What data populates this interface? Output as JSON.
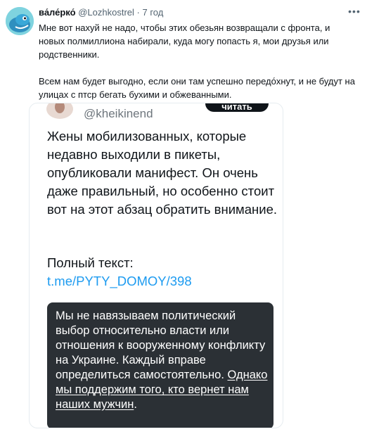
{
  "post": {
    "author_name": "ва́ле́рко́",
    "handle": "@Lozhkostrel",
    "separator": "·",
    "time": "7 год",
    "more_icon": "more-horizontal-icon",
    "paragraph1": "Мне вот нахуй не надо, чтобы этих обезьян возвращали с фронта, и новых полмиллиона набирали, куда могу попасть я, мои друзья или родственники.",
    "paragraph2": "Всем нам будет выгодно, если они там успешно передо́хнут, и не будут на улицах с птср бегать бухими и обжеванными."
  },
  "quoted": {
    "handle": "@kheikinend",
    "button_label": "читать",
    "text": "Жены мобилизованных, которые недавно выходили в пикеты, опубликовали манифест. Он очень даже правильный, но особенно стоит вот на этот абзац обратить внимание.",
    "full_text_label": "Полный текст: ",
    "link": "t.me/PYTY_DOMOY/398",
    "excerpt_plain": "Мы не навязываем политический выбор относительно власти или отношения к вооруженному конфликту на Украине. Каждый вправе определиться самостоятельно. ",
    "excerpt_underlined": "Однако мы поддержим того, кто вернет нам наших мужчин",
    "excerpt_end": "."
  },
  "colors": {
    "text": "#0f1419",
    "muted": "#536471",
    "link": "#1d9bf0",
    "dark_block": "#2b3035",
    "avatar_bg": "#7fd3df"
  }
}
